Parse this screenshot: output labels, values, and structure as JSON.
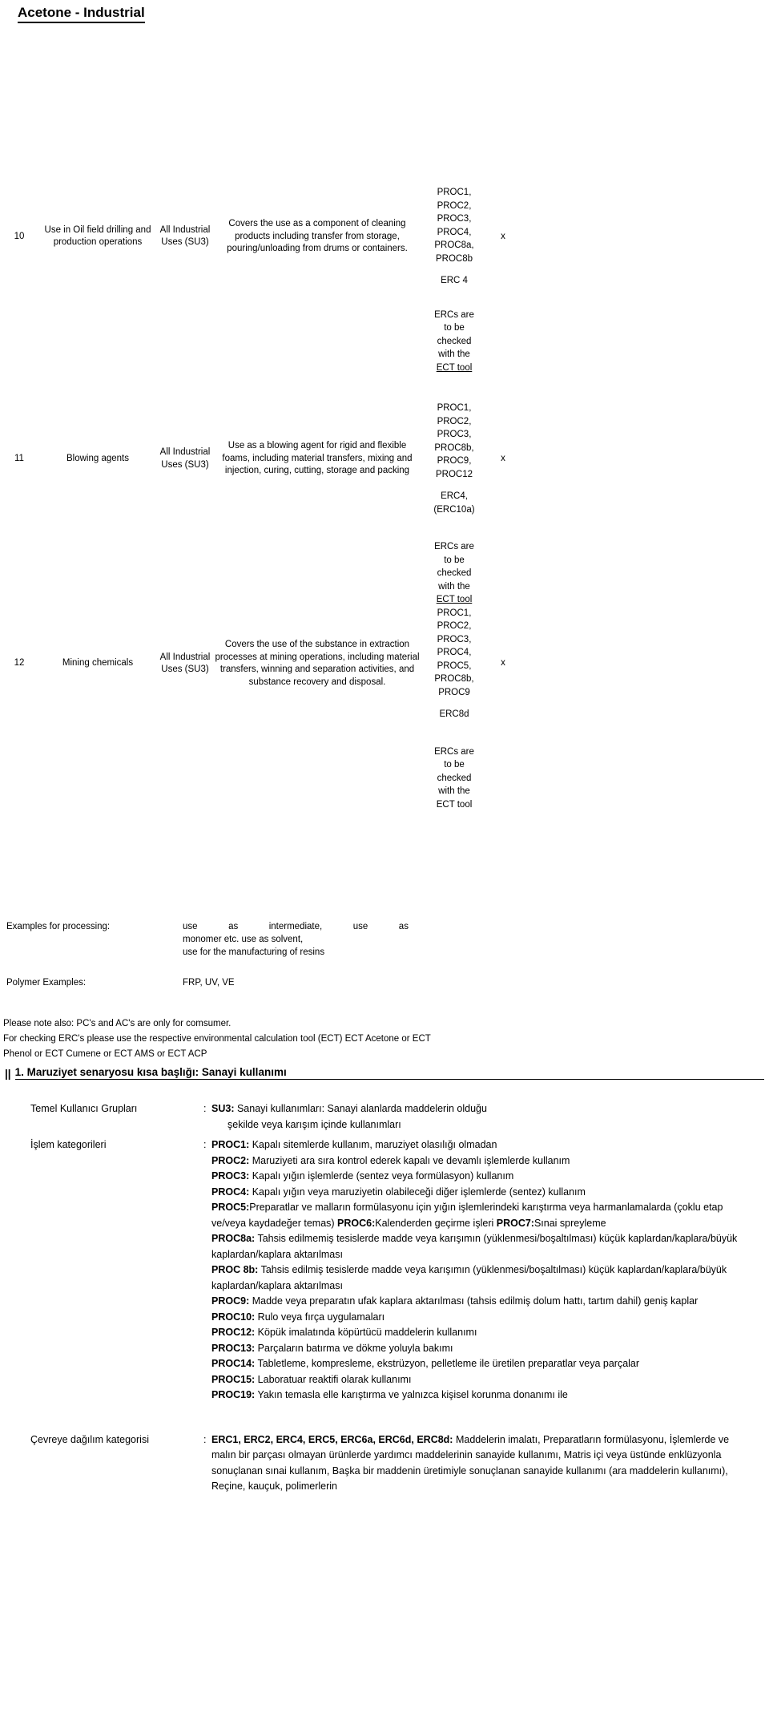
{
  "document": {
    "title": "Acetone - Industrial"
  },
  "use_table": {
    "rows": [
      {
        "no": "10",
        "use_title": "Use in Oil field drilling and production operations",
        "sector": "All Industrial Uses (SU3)",
        "description": "Covers the use as a component of cleaning products including transfer from storage, pouring/unloading from drums or containers.",
        "proc": "PROC1, PROC2, PROC3, PROC4, PROC8a, PROC8b",
        "erc": "ERC 4",
        "mark": "x"
      },
      {
        "no": "11",
        "use_title": "Blowing agents",
        "sector": "All Industrial Uses (SU3)",
        "description": "Use as a blowing agent for rigid and flexible foams, including material transfers, mixing and injection, curing, cutting, storage and packing",
        "proc": "PROC1, PROC2, PROC3, PROC8b, PROC9, PROC12",
        "erc": "ERC4, (ERC10a)",
        "mark": "x"
      },
      {
        "no": "12",
        "use_title": "Mining chemicals",
        "sector": "All Industrial Uses (SU3)",
        "description": "Covers the use of the substance in extraction processes at mining operations, including material transfers, winning and separation activities, and substance recovery and disposal.",
        "proc": "PROC1, PROC2, PROC3, PROC4, PROC5, PROC8b, PROC9",
        "erc": "ERC8d",
        "mark": "x"
      }
    ],
    "erc_note": {
      "line1": "ERCs are",
      "line2": "to be",
      "line3": "checked",
      "line4": "with the",
      "line5": "ECT tool"
    }
  },
  "examples": {
    "processing_label": "Examples for processing:",
    "processing_line1_words": [
      "use",
      "as",
      "intermediate,",
      "use",
      "as"
    ],
    "processing_line2": "monomer etc. use as solvent,",
    "processing_line3": "use for the manufacturing of resins",
    "polymer_label": "Polymer Examples:",
    "polymer_value": "FRP, UV, VE"
  },
  "notes": {
    "note1": "Please note also: PC's and AC's are only for comsumer.",
    "note2": "For checking ERC's please use the respective environmental calculation tool (ECT) ECT  Acetone or ECT",
    "note3": "Phenol or ECT Cumene or ECT AMS or ECT ACP"
  },
  "section": {
    "bars": "||",
    "heading": "1. Maruziyet senaryosu kısa başlığı: Sanayi kullanımı"
  },
  "definitions": {
    "user_groups": {
      "label": "Temel Kullanıcı Grupları",
      "colon": ":",
      "code": "SU3:",
      "text_line1": "Sanayi kullanımları: Sanayi alanlarda maddelerin olduğu",
      "text_line2": "şekilde veya karışım içinde kullanımları"
    },
    "process_categories": {
      "label": "İşlem kategorileri",
      "colon": ":",
      "items": [
        {
          "code": "PROC1:",
          "text": "Kapalı sitemlerde kullanım, maruziyet olasılığı",
          "cont": "olmadan"
        },
        {
          "code": "PROC2:",
          "text": "Maruziyeti ara sıra kontrol ederek kapalı ve devamlı",
          "cont": "işlemlerde kullanım"
        },
        {
          "code": "PROC3:",
          "text": "Kapalı yığın işlemlerde (sentez veya formülasyon) kullanım",
          "cont": ""
        },
        {
          "code": "PROC4:",
          "text": "Kapalı yığın veya maruziyetin olabileceği diğer işlemlerde",
          "cont": "(sentez) kullanım"
        },
        {
          "code": "PROC5:",
          "text": "Preparatlar ve malların formülasyonu için yığın işlemlerindeki karıştırma veya harmanlamalarda (çoklu etap ve/veya kaydadeğer temas) ",
          "cont": ""
        },
        {
          "code": "PROC6:",
          "text": "Kalenderden geçirme işleri ",
          "cont": ""
        },
        {
          "code": "PROC7:",
          "text": "Sınai spreyleme",
          "cont": ""
        },
        {
          "code": "PROC8a:",
          "text": "Tahsis edilmemiş tesislerde madde veya karışımın (yüklenmesi/boşaltılması) küçük kaplardan/kaplara/büyük kaplardan/kaplara aktarılması",
          "cont": ""
        },
        {
          "code": "PROC 8b:",
          "text": "Tahsis edilmiş tesislerde madde veya karışımın (yüklenmesi/boşaltılması) küçük kaplardan/kaplara/büyük kaplardan/kaplara aktarılması",
          "cont": ""
        },
        {
          "code": "PROC9:",
          "text": "Madde veya preparatın ufak kaplara aktarılması (tahsis edilmiş dolum hattı, tartım dahil) geniş kaplar",
          "cont": ""
        },
        {
          "code": "PROC10:",
          "text": "Rulo veya fırça uygulamaları",
          "cont": ""
        },
        {
          "code": "PROC12:",
          "text": "Köpük imalatında köpürtücü maddelerin kullanımı",
          "cont": ""
        },
        {
          "code": "PROC13:",
          "text": "Parçaların batırma ve dökme yoluyla bakımı",
          "cont": ""
        },
        {
          "code": "PROC14:",
          "text": "Tabletleme, kompresleme, ekstrüzyon, pelletleme ile üretilen preparatlar veya parçalar",
          "cont": ""
        },
        {
          "code": "PROC15:",
          "text": "Laboratuar reaktifi olarak kullanımı",
          "cont": ""
        },
        {
          "code": "PROC19:",
          "text": "Yakın temasla elle karıştırma ve yalnızca kişisel korunma donanımı ile",
          "cont": ""
        }
      ]
    },
    "release_categories": {
      "label": "Çevreye dağılım kategorisi",
      "colon": ":",
      "codes": "ERC1, ERC2, ERC4, ERC5, ERC6a, ERC6d, ERC8d:",
      "text": "Maddelerin imalatı, Preparatların formülasyonu, İşlemlerde ve malın bir parçası olmayan ürünlerde yardımcı maddelerinin sanayide kullanımı, Matris içi veya üstünde enklüzyonla sonuçlanan sınai kullanım, Başka bir maddenin üretimiyle sonuçlanan sanayide kullanımı (ara maddelerin kullanımı), Reçine, kauçuk, polimerlerin"
    }
  }
}
